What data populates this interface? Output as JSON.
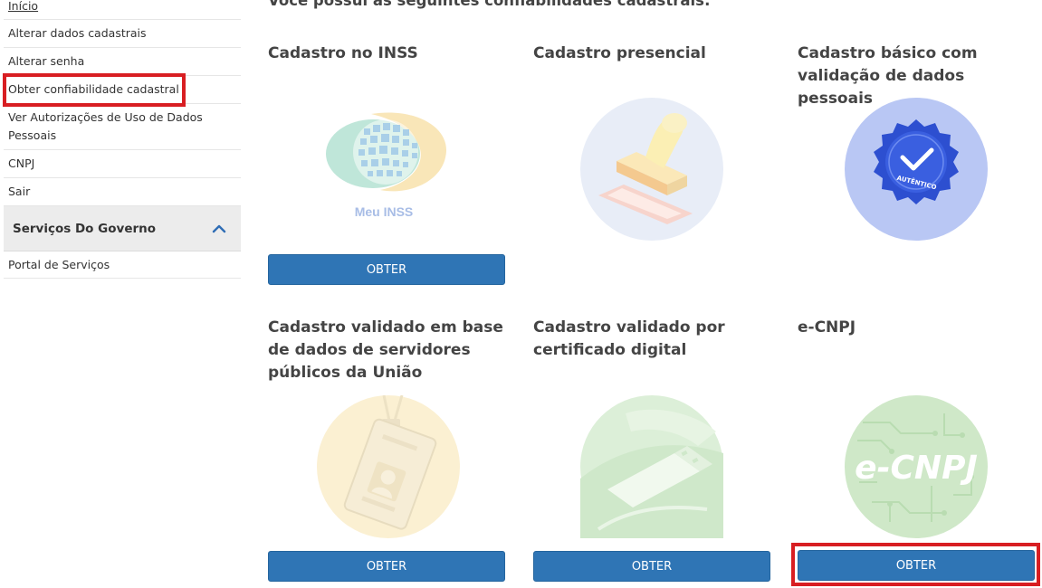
{
  "sidebar": {
    "items": [
      {
        "label": "Início"
      },
      {
        "label": "Alterar dados cadastrais"
      },
      {
        "label": "Alterar senha"
      },
      {
        "label": "Obter confiabilidade cadastral"
      },
      {
        "label": "Ver Autorizações de Uso de Dados Pessoais"
      },
      {
        "label": "CNPJ"
      },
      {
        "label": "Sair"
      }
    ],
    "section": {
      "title": "Serviços Do Governo",
      "icon": "chevron-up-icon"
    },
    "section_items": [
      {
        "label": "Portal de Serviços"
      }
    ]
  },
  "main": {
    "title": "Você possui as seguintes confiabilidades cadastrais:",
    "cards": [
      {
        "title": "Cadastro no INSS",
        "image_text": "Meu INSS",
        "button": "OBTER"
      },
      {
        "title": "Cadastro presencial",
        "button": ""
      },
      {
        "title": "Cadastro básico com validação de dados pessoais",
        "image_text": "AUTÊNTICO",
        "button": ""
      },
      {
        "title": "Cadastro validado em base de dados de servidores públicos da União",
        "button": "OBTER"
      },
      {
        "title": "Cadastro validado por certificado digital",
        "button": "OBTER"
      },
      {
        "title": "e-CNPJ",
        "image_text": "e-CNPJ",
        "button": "OBTER"
      }
    ]
  },
  "colors": {
    "button": "#2f75b5",
    "highlight": "#d81e22"
  }
}
